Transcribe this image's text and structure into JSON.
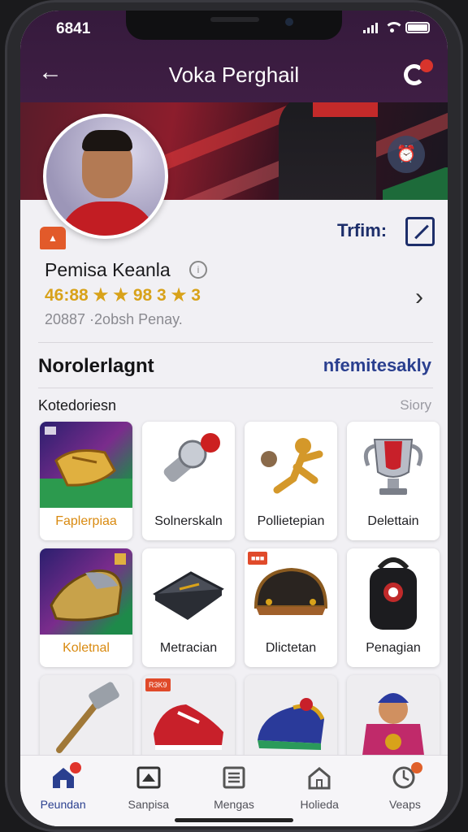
{
  "status": {
    "time": "6841"
  },
  "header": {
    "title": "Voka Perghail"
  },
  "profile": {
    "team_label": "Trfim:",
    "name": "Pemisa Keanla",
    "info_glyph": "i",
    "stats": "46:88 ★ ★ 98 3 ★ 3",
    "subtext": "20887 ·2obsh Penay."
  },
  "section": {
    "title": "Norolerlagnt",
    "link": "nfemitesakly",
    "category_label": "Kotedoriesn",
    "sort_label": "Siory"
  },
  "grid": {
    "items": [
      {
        "label": "Faplerpiaa",
        "tag": ""
      },
      {
        "label": "Solnerskaln",
        "tag": ""
      },
      {
        "label": "Pollietepian",
        "tag": ""
      },
      {
        "label": "Delettain",
        "tag": ""
      },
      {
        "label": "Koletnal",
        "tag": ""
      },
      {
        "label": "Metracian",
        "tag": ""
      },
      {
        "label": "Dlictetan",
        "tag": ""
      },
      {
        "label": "Penagian",
        "tag": ""
      }
    ],
    "partial_tags": [
      "",
      "R3K9",
      "",
      ""
    ]
  },
  "nav": {
    "items": [
      {
        "label": "Peundan",
        "icon": "home-icon",
        "active": true
      },
      {
        "label": "Sanpisa",
        "icon": "cards-icon",
        "active": false
      },
      {
        "label": "Mengas",
        "icon": "list-icon",
        "active": false
      },
      {
        "label": "Holieda",
        "icon": "house-icon",
        "active": false
      },
      {
        "label": "Veaps",
        "icon": "globe-icon",
        "active": false
      }
    ]
  },
  "colors": {
    "header_bg": "#351a3c",
    "accent": "#2a3f8f",
    "gold": "#d8a21a",
    "badge_red": "#e0342c"
  }
}
